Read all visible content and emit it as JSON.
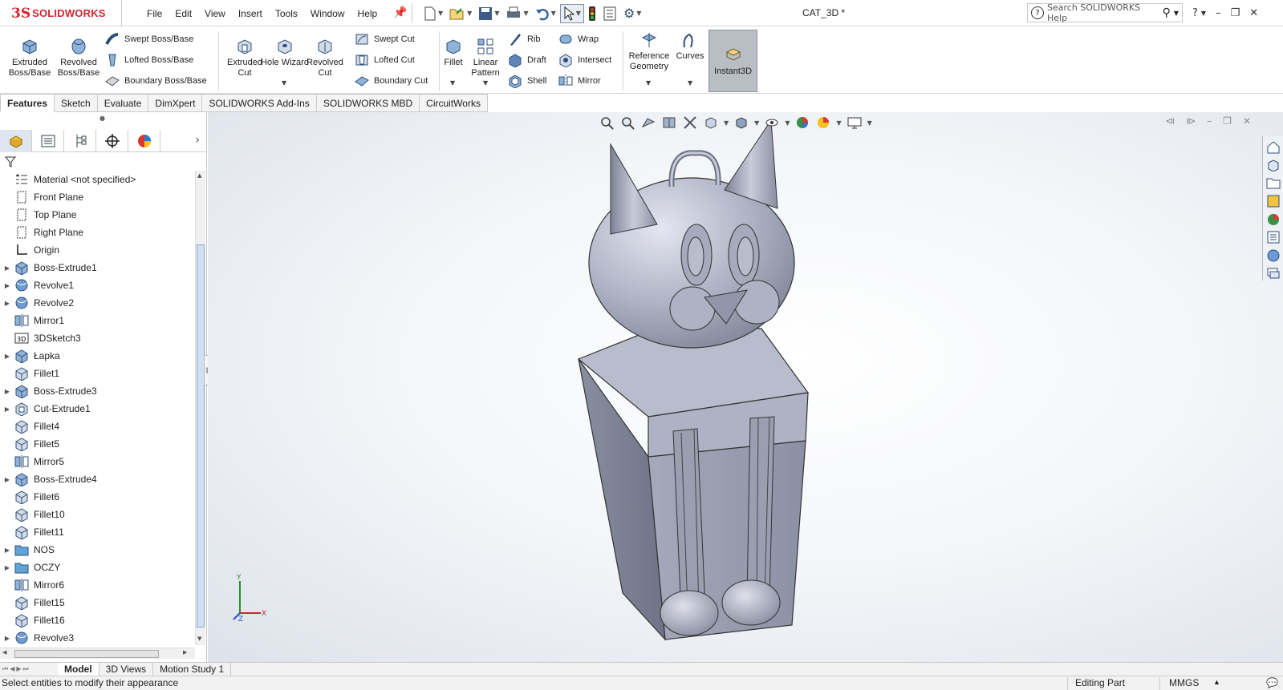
{
  "app": {
    "logo_ds": "3S",
    "logo_name": "SOLIDWORKS",
    "document_title": "CAT_3D *"
  },
  "menu": [
    "File",
    "Edit",
    "View",
    "Insert",
    "Tools",
    "Window",
    "Help"
  ],
  "search": {
    "placeholder": "Search SOLIDWORKS Help"
  },
  "window_controls": [
    "?",
    "–",
    "❐",
    "✕"
  ],
  "features_toolbar": {
    "extruded_boss": "Extruded Boss/Base",
    "revolved_boss": "Revolved Boss/Base",
    "swept_boss": "Swept Boss/Base",
    "lofted_boss": "Lofted Boss/Base",
    "boundary_boss": "Boundary Boss/Base",
    "extruded_cut": "Extruded Cut",
    "hole_wizard": "Hole Wizard",
    "revolved_cut": "Revolved Cut",
    "swept_cut": "Swept Cut",
    "lofted_cut": "Lofted Cut",
    "boundary_cut": "Boundary Cut",
    "fillet": "Fillet",
    "linear_pattern": "Linear Pattern",
    "rib": "Rib",
    "draft": "Draft",
    "shell": "Shell",
    "wrap": "Wrap",
    "intersect": "Intersect",
    "mirror": "Mirror",
    "reference_geometry": "Reference Geometry",
    "curves": "Curves",
    "instant3d": "Instant3D"
  },
  "tabs": [
    "Features",
    "Sketch",
    "Evaluate",
    "DimXpert",
    "SOLIDWORKS Add-Ins",
    "SOLIDWORKS MBD",
    "CircuitWorks"
  ],
  "tree": [
    {
      "label": "Material <not specified>",
      "icon": "material-icon",
      "expandable": false
    },
    {
      "label": "Front Plane",
      "icon": "plane-icon",
      "expandable": false
    },
    {
      "label": "Top Plane",
      "icon": "plane-icon",
      "expandable": false
    },
    {
      "label": "Right Plane",
      "icon": "plane-icon",
      "expandable": false
    },
    {
      "label": "Origin",
      "icon": "origin-icon",
      "expandable": false
    },
    {
      "label": "Boss-Extrude1",
      "icon": "extrude-icon",
      "expandable": true
    },
    {
      "label": "Revolve1",
      "icon": "revolve-icon",
      "expandable": true
    },
    {
      "label": "Revolve2",
      "icon": "revolve-icon",
      "expandable": true
    },
    {
      "label": "Mirror1",
      "icon": "mirror-icon",
      "expandable": false
    },
    {
      "label": "3DSketch3",
      "icon": "sketch3d-icon",
      "expandable": false
    },
    {
      "label": "Łapka",
      "icon": "extrude-icon",
      "expandable": true
    },
    {
      "label": "Fillet1",
      "icon": "fillet-icon",
      "expandable": false
    },
    {
      "label": "Boss-Extrude3",
      "icon": "extrude-icon",
      "expandable": true
    },
    {
      "label": "Cut-Extrude1",
      "icon": "cut-icon",
      "expandable": true
    },
    {
      "label": "Fillet4",
      "icon": "fillet-icon",
      "expandable": false
    },
    {
      "label": "Fillet5",
      "icon": "fillet-icon",
      "expandable": false
    },
    {
      "label": "Mirror5",
      "icon": "mirror-icon",
      "expandable": false
    },
    {
      "label": "Boss-Extrude4",
      "icon": "extrude-icon",
      "expandable": true
    },
    {
      "label": "Fillet6",
      "icon": "fillet-icon",
      "expandable": false
    },
    {
      "label": "Fillet10",
      "icon": "fillet-icon",
      "expandable": false
    },
    {
      "label": "Fillet11",
      "icon": "fillet-icon",
      "expandable": false
    },
    {
      "label": "NOS",
      "icon": "folder-icon",
      "expandable": true
    },
    {
      "label": "OCZY",
      "icon": "folder-icon",
      "expandable": true
    },
    {
      "label": "Mirror6",
      "icon": "mirror-icon",
      "expandable": false
    },
    {
      "label": "Fillet15",
      "icon": "fillet-icon",
      "expandable": false
    },
    {
      "label": "Fillet16",
      "icon": "fillet-icon",
      "expandable": false
    },
    {
      "label": "Revolve3",
      "icon": "revolve-icon",
      "expandable": true
    }
  ],
  "bottom_tabs": [
    "Model",
    "3D Views",
    "Motion Study 1"
  ],
  "status": {
    "message": "Select entities to modify their appearance",
    "mode": "Editing Part",
    "units": "MMGS"
  },
  "triad": {
    "x": "X",
    "y": "Y",
    "z": "Z"
  },
  "colors": {
    "accent": "#d5232f",
    "model": "#9ea3b6",
    "viewport_bg": "#e6eaf0"
  }
}
